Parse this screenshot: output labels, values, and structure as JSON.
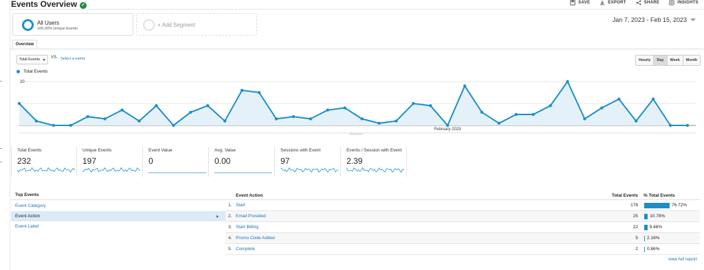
{
  "header": {
    "title": "Events Overview",
    "toolbar": [
      {
        "label": "SAVE",
        "icon": "save-icon"
      },
      {
        "label": "EXPORT",
        "icon": "export-icon"
      },
      {
        "label": "SHARE",
        "icon": "share-icon"
      },
      {
        "label": "INSIGHTS",
        "icon": "insights-icon"
      }
    ]
  },
  "segments": {
    "active": {
      "name": "All Users",
      "sub": "100.00% Unique Events"
    },
    "add_label": "+ Add Segment"
  },
  "date_range": "Jan 7, 2023 - Feb 15, 2023",
  "tabs": {
    "overview": "Overview"
  },
  "controls": {
    "metric": "Total Events",
    "vs": "VS.",
    "select_metric": "Select a metric",
    "granularity": [
      "Hourly",
      "Day",
      "Week",
      "Month"
    ],
    "granularity_active": "Day"
  },
  "chart_data": {
    "type": "area",
    "title": "",
    "series": [
      {
        "name": "Total Events",
        "color": "#1b8fc9",
        "values": [
          10,
          2,
          0,
          0,
          4,
          3,
          7,
          2,
          9,
          0,
          6,
          9,
          2,
          16,
          15,
          3,
          4,
          3,
          7,
          8,
          3,
          1,
          2,
          10,
          9,
          0,
          18,
          6,
          1,
          5,
          5,
          9,
          20,
          3,
          8,
          12,
          2,
          12,
          0,
          0
        ]
      }
    ],
    "y_tick_label": "20",
    "ylim": [
      0,
      20
    ],
    "x_tick_label": "February 2023",
    "grid": true,
    "area_fill": "#e5f1f8"
  },
  "scorecards": [
    {
      "label": "Total Events",
      "value": "232"
    },
    {
      "label": "Unique Events",
      "value": "197"
    },
    {
      "label": "Event Value",
      "value": "0"
    },
    {
      "label": "Avg. Value",
      "value": "0.00"
    },
    {
      "label": "Sessions with Event",
      "value": "97"
    },
    {
      "label": "Events / Session with Event",
      "value": "2.39"
    }
  ],
  "top_events": {
    "heading": "Top Events",
    "items": [
      "Event Category",
      "Event Action",
      "Event Label"
    ],
    "active": "Event Action"
  },
  "table": {
    "headers": {
      "action": "Event Action",
      "total": "Total Events",
      "pct": "% Total Events"
    },
    "rows": [
      {
        "idx": "1.",
        "name": "Start",
        "total": "178",
        "pct": "76.72%",
        "pct_value": 76.72
      },
      {
        "idx": "2.",
        "name": "Email Provided",
        "total": "25",
        "pct": "10.78%",
        "pct_value": 10.78
      },
      {
        "idx": "3.",
        "name": "Start Billing",
        "total": "22",
        "pct": "9.48%",
        "pct_value": 9.48
      },
      {
        "idx": "4.",
        "name": "Promo Code Added",
        "total": "5",
        "pct": "2.16%",
        "pct_value": 2.16
      },
      {
        "idx": "5.",
        "name": "Complete",
        "total": "2",
        "pct": "0.86%",
        "pct_value": 0.86
      }
    ],
    "view_full": "view full report"
  }
}
